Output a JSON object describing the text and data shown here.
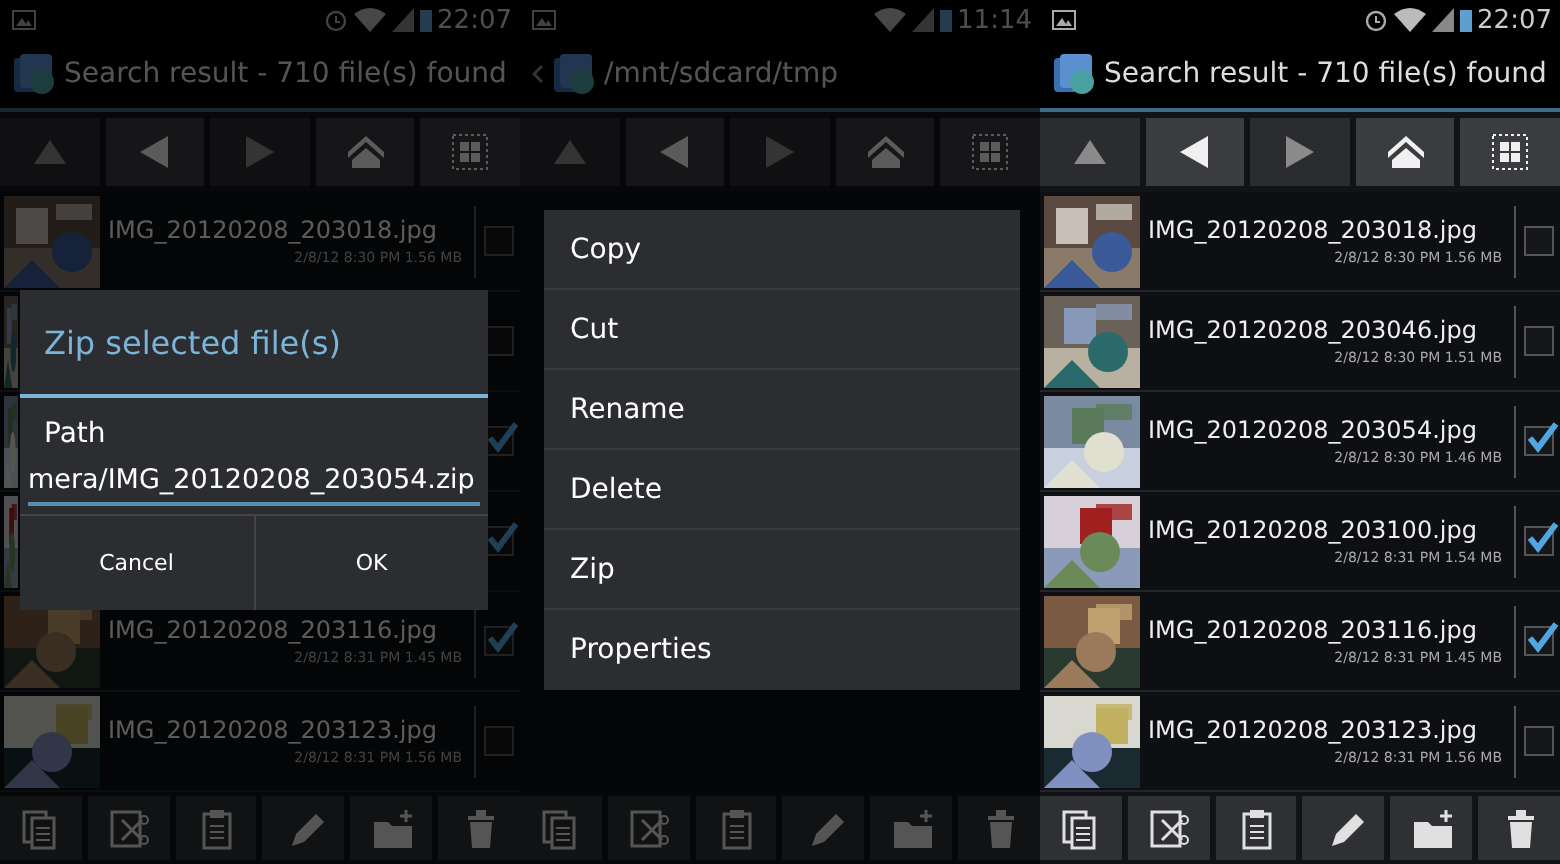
{
  "screens": [
    {
      "status_bar": {
        "time": "22:07",
        "alarm": true
      },
      "title": "Search result - 710 file(s) found",
      "back_caret": false,
      "dimmed": true,
      "nav": [
        {
          "kind": "up",
          "enabled": false
        },
        {
          "kind": "back",
          "enabled": true
        },
        {
          "kind": "forward",
          "enabled": false
        },
        {
          "kind": "home",
          "enabled": true
        },
        {
          "kind": "select",
          "enabled": true
        }
      ],
      "rows": [
        {
          "name": "IMG_20120208_203018.jpg",
          "meta": "2/8/12 8:30 PM  1.56 MB",
          "checked": false
        },
        {
          "checked": false
        },
        {
          "checked": true
        },
        {
          "checked": true
        },
        {
          "name": "IMG_20120208_203116.jpg",
          "meta": "2/8/12 8:31 PM  1.45 MB",
          "checked": true
        },
        {
          "name": "IMG_20120208_203123.jpg",
          "meta": "2/8/12 8:31 PM  1.56 MB",
          "checked": false
        }
      ],
      "toolbar": [
        {
          "kind": "copy"
        },
        {
          "kind": "cut"
        },
        {
          "kind": "paste"
        },
        {
          "kind": "rename"
        },
        {
          "kind": "new-folder"
        },
        {
          "kind": "delete"
        }
      ],
      "dialog": {
        "title": "Zip selected file(s)",
        "label": "Path",
        "value": "mera/IMG_20120208_203054.zip",
        "buttons": [
          "Cancel",
          "OK"
        ]
      }
    },
    {
      "status_bar": {
        "time": "11:14",
        "alarm": false
      },
      "title": "/mnt/sdcard/tmp",
      "back_caret": true,
      "dimmed": true,
      "nav": [
        {
          "kind": "up",
          "enabled": false
        },
        {
          "kind": "back",
          "enabled": true
        },
        {
          "kind": "forward",
          "enabled": false
        },
        {
          "kind": "home",
          "enabled": true
        },
        {
          "kind": "select",
          "enabled": true
        }
      ],
      "toolbar": [
        {
          "kind": "copy"
        },
        {
          "kind": "cut"
        },
        {
          "kind": "paste"
        },
        {
          "kind": "rename"
        },
        {
          "kind": "new-folder"
        },
        {
          "kind": "delete"
        }
      ],
      "menu": [
        "Copy",
        "Cut",
        "Rename",
        "Delete",
        "Zip",
        "Properties"
      ]
    },
    {
      "status_bar": {
        "time": "22:07",
        "alarm": true
      },
      "title": "Search result - 710 file(s) found",
      "back_caret": false,
      "dimmed": false,
      "nav": [
        {
          "kind": "up",
          "enabled": false
        },
        {
          "kind": "back",
          "enabled": true
        },
        {
          "kind": "forward",
          "enabled": false
        },
        {
          "kind": "home",
          "enabled": true
        },
        {
          "kind": "select",
          "enabled": true
        }
      ],
      "rows": [
        {
          "name": "IMG_20120208_203018.jpg",
          "meta": "2/8/12 8:30 PM  1.56 MB",
          "checked": false
        },
        {
          "name": "IMG_20120208_203046.jpg",
          "meta": "2/8/12 8:30 PM  1.51 MB",
          "checked": false
        },
        {
          "name": "IMG_20120208_203054.jpg",
          "meta": "2/8/12 8:30 PM  1.46 MB",
          "checked": true
        },
        {
          "name": "IMG_20120208_203100.jpg",
          "meta": "2/8/12 8:31 PM  1.54 MB",
          "checked": true
        },
        {
          "name": "IMG_20120208_203116.jpg",
          "meta": "2/8/12 8:31 PM  1.45 MB",
          "checked": true
        },
        {
          "name": "IMG_20120208_203123.jpg",
          "meta": "2/8/12 8:31 PM  1.56 MB",
          "checked": false
        }
      ],
      "toolbar": [
        {
          "kind": "copy"
        },
        {
          "kind": "cut"
        },
        {
          "kind": "paste"
        },
        {
          "kind": "rename"
        },
        {
          "kind": "new-folder"
        },
        {
          "kind": "delete"
        }
      ]
    }
  ]
}
